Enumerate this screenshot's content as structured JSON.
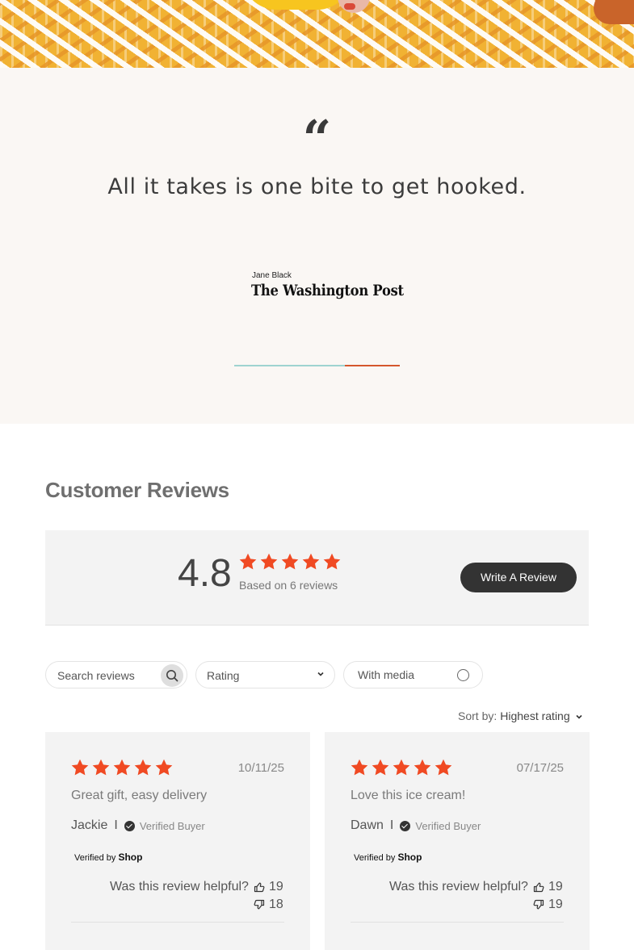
{
  "quote": {
    "mark": "“",
    "text": "All it takes is one bite to get hooked.",
    "byline": "Jane Black",
    "publication": "The Washington Post"
  },
  "reviews": {
    "title": "Customer Reviews",
    "average": "4.8",
    "based_on": "Based on 6 reviews",
    "write_button": "Write A Review",
    "star_color": "#f04a23",
    "filters": {
      "search_placeholder": "Search reviews",
      "rating_label": "Rating",
      "media_label": "With media"
    },
    "sort": {
      "label": "Sort by:",
      "value": "Highest rating"
    },
    "items": [
      {
        "rating": 5,
        "date": "10/11/25",
        "title": "Great gift, easy delivery",
        "author": "Jackie",
        "badge": "Verified Buyer",
        "verified_by": "Verified by",
        "shop": "Shop",
        "helpful_label": "Was this review helpful?",
        "up": "19",
        "down": "18"
      },
      {
        "rating": 5,
        "date": "07/17/25",
        "title": "Love this ice cream!",
        "author": "Dawn",
        "badge": "Verified Buyer",
        "verified_by": "Verified by",
        "shop": "Shop",
        "helpful_label": "Was this review helpful?",
        "up": "19",
        "down": "19"
      }
    ]
  }
}
